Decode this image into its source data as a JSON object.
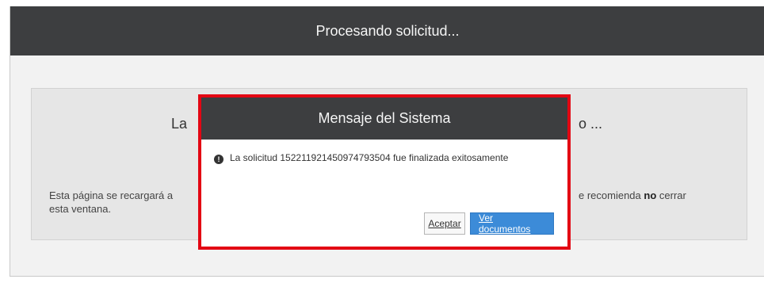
{
  "outer_dialog": {
    "title": "Procesando solicitud...",
    "background_heading_left": "La",
    "background_heading_right": "o ...",
    "background_text_left": "Esta página se recargará a",
    "background_text_left_2": "esta ventana.",
    "background_text_right_prefix": "e recomienda ",
    "background_text_right_bold": "no",
    "background_text_right_suffix": " cerrar"
  },
  "modal": {
    "title": "Mensaje del Sistema",
    "message": "La solicitud 152211921450974793504 fue finalizada exitosamente",
    "icon": "info-icon",
    "buttons": {
      "accept": "Aceptar",
      "documents": "Ver documentos"
    }
  },
  "colors": {
    "header_bg": "#3d3e40",
    "highlight": "#e30613",
    "primary_button": "#3c8bd8"
  }
}
